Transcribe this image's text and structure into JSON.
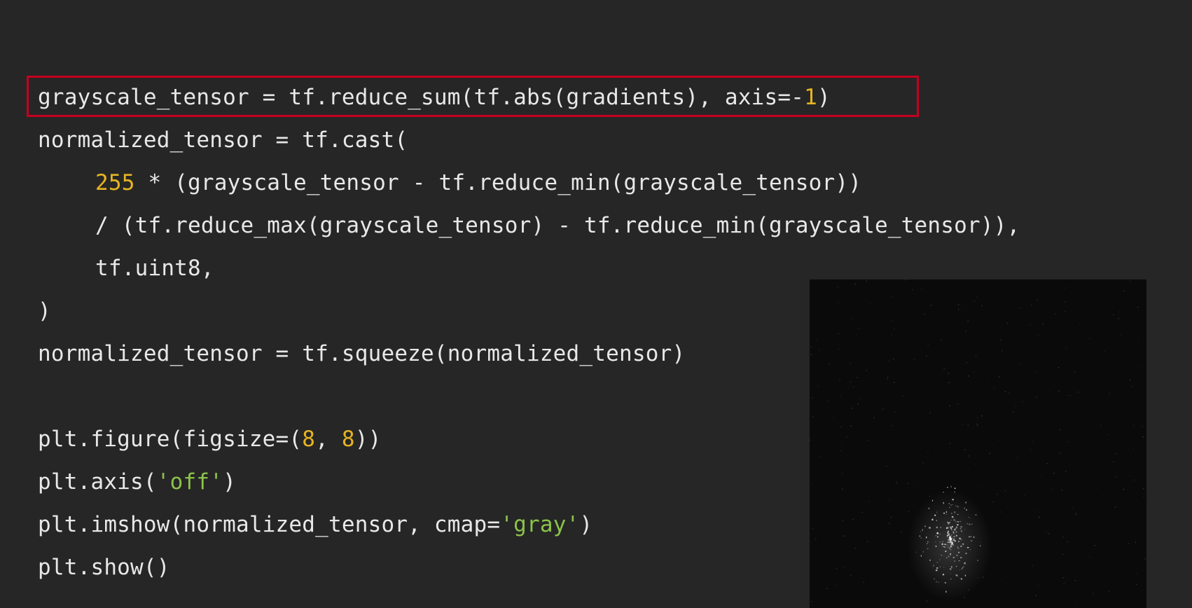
{
  "code": {
    "line1": "grayscale_tensor = tf.reduce_sum(tf.abs(gradients), axis=-",
    "line1_num": "1",
    "line1_end": ")",
    "line2": "normalized_tensor = tf.cast(",
    "line3_num": "255",
    "line3_rest": " * (grayscale_tensor - tf.reduce_min(grayscale_tensor))",
    "line4": "/ (tf.reduce_max(grayscale_tensor) - tf.reduce_min(grayscale_tensor)),",
    "line5": "tf.uint8,",
    "line6": ")",
    "line7": "normalized_tensor = tf.squeeze(normalized_tensor)",
    "line9_a": "plt.figure(figsize=(",
    "line9_num1": "8",
    "line9_b": ", ",
    "line9_num2": "8",
    "line9_c": "))",
    "line10_a": "plt.axis(",
    "line10_str": "'off'",
    "line10_b": ")",
    "line11_a": "plt.imshow(normalized_tensor, cmap=",
    "line11_str": "'gray'",
    "line11_b": ")",
    "line12": "plt.show()"
  },
  "colors": {
    "background": "#262626",
    "text": "#e8e8e8",
    "number": "#e6b422",
    "string": "#8bc34a",
    "highlight": "#c5001e"
  }
}
